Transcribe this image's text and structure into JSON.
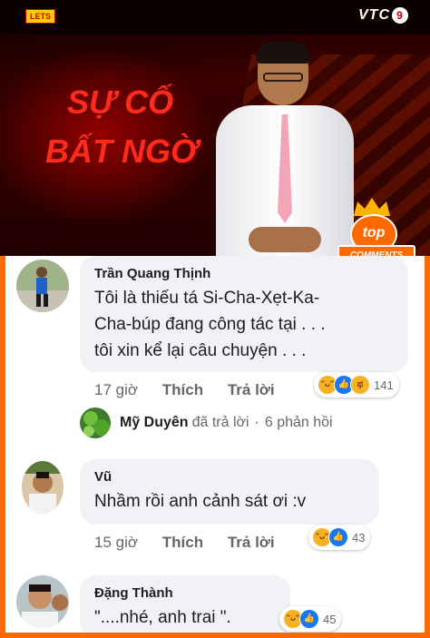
{
  "video": {
    "channel_logo": "VTC",
    "channel_number": "9",
    "corner_logo": "LETS",
    "show_title_line1": "SỰ CỐ",
    "show_title_line2": "BẤT NGỜ",
    "badge_top": "top",
    "badge_bottom": "COMMENTS"
  },
  "comments": [
    {
      "author": "Trần Quang Thịnh",
      "text_line1": "Tôi là thiếu tá Si-Cha-Xẹt-Ka-",
      "text_line2": "Cha-búp đang công tác tại . . .",
      "text_line3": "tôi xin kể lại câu chuyện . . .",
      "time": "17 giờ",
      "like_label": "Thích",
      "reply_label": "Trả lời",
      "reaction_count": "141",
      "reactions": [
        "haha-icon",
        "like-icon",
        "sad-icon"
      ],
      "replies": {
        "name": "Mỹ Duyên",
        "action": "đã trả lời",
        "separator": "·",
        "count": "6 phản hồi"
      }
    },
    {
      "author": "Vũ",
      "text_line1": "Nhầm rồi anh cảnh sát ơi :v",
      "time": "15 giờ",
      "like_label": "Thích",
      "reply_label": "Trả lời",
      "reaction_count": "43",
      "reactions": [
        "haha-icon",
        "like-icon"
      ]
    },
    {
      "author": "Đặng Thành",
      "text_line1": "\"....nhé, anh trai \".",
      "reaction_count": "45",
      "reactions": [
        "haha-icon",
        "like-icon"
      ]
    }
  ],
  "colors": {
    "frame": "#ff6a00",
    "bubble": "#f0f2f5",
    "like_blue": "#1877f2",
    "emoji_yellow": "#f7b125"
  }
}
